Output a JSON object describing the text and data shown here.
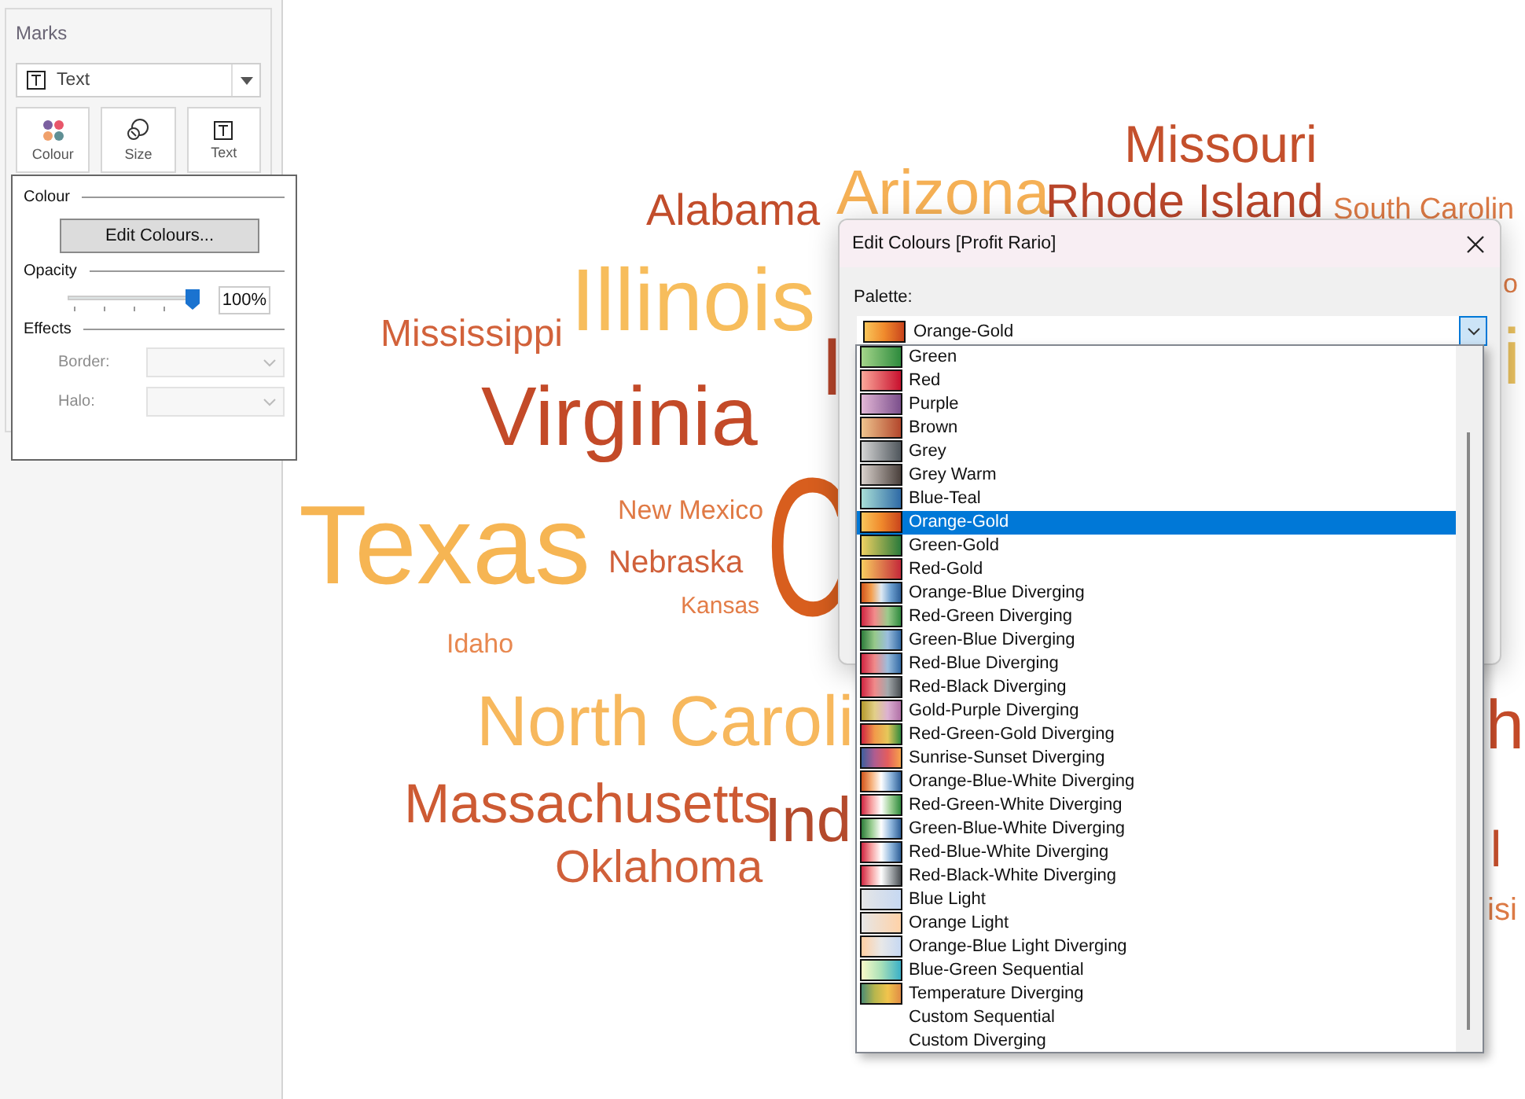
{
  "marks_card": {
    "title": "Marks",
    "mark_type": "Text",
    "buttons": [
      {
        "label": "Colour",
        "kind": "colour"
      },
      {
        "label": "Size",
        "kind": "size"
      },
      {
        "label": "Text",
        "kind": "text"
      }
    ]
  },
  "colour_popup": {
    "colour_heading": "Colour",
    "edit_button": "Edit Colours...",
    "opacity_heading": "Opacity",
    "opacity": {
      "level": 1,
      "reading": "100%"
    },
    "effects_heading": "Effects",
    "effects": [
      {
        "label": "Border:",
        "disabled": true
      },
      {
        "label": "Halo:",
        "disabled": true
      }
    ]
  },
  "word_cloud": [
    {
      "text": "Missouri",
      "color": "#c4502c"
    },
    {
      "text": "Alabama",
      "color": "#c24d2b"
    },
    {
      "text": "Arizona",
      "color": "#f5b055"
    },
    {
      "text": "Rhode Island",
      "color": "#b8452a"
    },
    {
      "text": "South Carolin",
      "color": "#dc7a45"
    },
    {
      "text": "o",
      "color": "#dc7a45"
    },
    {
      "text": "Mississippi",
      "color": "#d2623b"
    },
    {
      "text": "Illinois",
      "color": "#f7bd5c"
    },
    {
      "text": "I",
      "color": "#b5452b"
    },
    {
      "text": "i",
      "color": "#e8c060"
    },
    {
      "text": "Virginia",
      "color": "#c34a28"
    },
    {
      "text": "Texas",
      "color": "#f6b553"
    },
    {
      "text": "New Mexico",
      "color": "#e07a45"
    },
    {
      "text": "Nebraska",
      "color": "#d0603a"
    },
    {
      "text": "Kansas",
      "color": "#e37d48"
    },
    {
      "text": "Idaho",
      "color": "#e88850"
    },
    {
      "text": "C",
      "color": "#d85e1e"
    },
    {
      "text": "North Caroli",
      "color": "#f7b85d"
    },
    {
      "text": "h",
      "color": "#c34a28"
    },
    {
      "text": "Massachusetts",
      "color": "#cd5a33"
    },
    {
      "text": "Ind",
      "color": "#b44a2c"
    },
    {
      "text": "l",
      "color": "#c24d2b"
    },
    {
      "text": "Oklahoma",
      "color": "#d0603a"
    },
    {
      "text": "isi",
      "color": "#dc7a45"
    }
  ],
  "dialog": {
    "title": "Edit Colours [Profit Rario]",
    "palette_label": "Palette:",
    "palette": {
      "value": "Orange-Gold"
    },
    "options": [
      {
        "label": "Green",
        "kind": "gradient",
        "selected": false
      },
      {
        "label": "Red",
        "kind": "gradient",
        "selected": false
      },
      {
        "label": "Purple",
        "kind": "gradient",
        "selected": false
      },
      {
        "label": "Brown",
        "kind": "gradient",
        "selected": false
      },
      {
        "label": "Grey",
        "kind": "gradient",
        "selected": false
      },
      {
        "label": "Grey Warm",
        "kind": "gradient",
        "selected": false
      },
      {
        "label": "Blue-Teal",
        "kind": "gradient",
        "selected": false
      },
      {
        "label": "Orange-Gold",
        "kind": "gradient",
        "selected": true
      },
      {
        "label": "Green-Gold",
        "kind": "gradient",
        "selected": false
      },
      {
        "label": "Red-Gold",
        "kind": "gradient",
        "selected": false
      },
      {
        "label": "Orange-Blue Diverging",
        "kind": "gradient",
        "selected": false
      },
      {
        "label": "Red-Green Diverging",
        "kind": "gradient",
        "selected": false
      },
      {
        "label": "Green-Blue Diverging",
        "kind": "gradient",
        "selected": false
      },
      {
        "label": "Red-Blue Diverging",
        "kind": "gradient",
        "selected": false
      },
      {
        "label": "Red-Black Diverging",
        "kind": "gradient",
        "selected": false
      },
      {
        "label": "Gold-Purple Diverging",
        "kind": "gradient",
        "selected": false
      },
      {
        "label": "Red-Green-Gold Diverging",
        "kind": "gradient",
        "selected": false
      },
      {
        "label": "Sunrise-Sunset Diverging",
        "kind": "gradient",
        "selected": false
      },
      {
        "label": "Orange-Blue-White Diverging",
        "kind": "gradient",
        "selected": false
      },
      {
        "label": "Red-Green-White Diverging",
        "kind": "gradient",
        "selected": false
      },
      {
        "label": "Green-Blue-White Diverging",
        "kind": "gradient",
        "selected": false
      },
      {
        "label": "Red-Blue-White Diverging",
        "kind": "gradient",
        "selected": false
      },
      {
        "label": "Red-Black-White Diverging",
        "kind": "gradient",
        "selected": false
      },
      {
        "label": "Blue Light",
        "kind": "gradient",
        "selected": false
      },
      {
        "label": "Orange Light",
        "kind": "gradient",
        "selected": false
      },
      {
        "label": "Orange-Blue Light Diverging",
        "kind": "gradient",
        "selected": false
      },
      {
        "label": "Blue-Green Sequential",
        "kind": "gradient",
        "selected": false
      },
      {
        "label": "Temperature Diverging",
        "kind": "gradient",
        "selected": false
      },
      {
        "label": "Custom Sequential",
        "kind": "custom",
        "selected": false
      },
      {
        "label": "Custom Diverging",
        "kind": "custom",
        "selected": false
      }
    ]
  }
}
